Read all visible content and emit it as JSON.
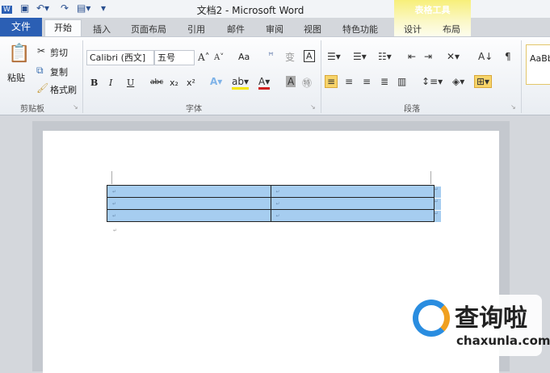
{
  "window": {
    "title": "文档2 - Microsoft Word"
  },
  "context_tab": {
    "label": "表格工具",
    "color": "#f7ef7a"
  },
  "tabs": [
    {
      "label": "文件"
    },
    {
      "label": "开始"
    },
    {
      "label": "插入"
    },
    {
      "label": "页面布局"
    },
    {
      "label": "引用"
    },
    {
      "label": "邮件"
    },
    {
      "label": "审阅"
    },
    {
      "label": "视图"
    },
    {
      "label": "特色功能"
    },
    {
      "label": "设计"
    },
    {
      "label": "布局"
    }
  ],
  "clipboard": {
    "paste": "粘贴",
    "cut": "剪切",
    "copy": "复制",
    "format_painter": "格式刷",
    "group": "剪贴板"
  },
  "font": {
    "name": "Calibri (西文]",
    "size": "五号",
    "group": "字体",
    "case": "Aa",
    "bold": "B",
    "italic": "I",
    "underline": "U",
    "strike": "abc",
    "sub": "x₂",
    "sup": "x²"
  },
  "paragraph": {
    "group": "段落"
  },
  "styles": {
    "preview": "AaBb"
  },
  "table": {
    "rows": 3,
    "cols": 2,
    "selection_color": "#a6cdf0"
  },
  "watermark": {
    "brand": "查询啦",
    "url": "chaxunla.com"
  }
}
